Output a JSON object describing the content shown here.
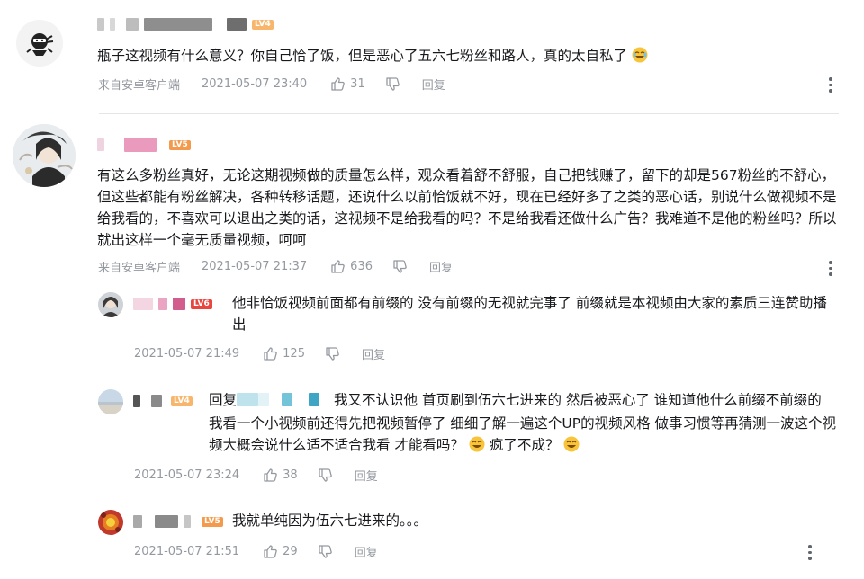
{
  "level_colors": {
    "lv4": "#f7b66c",
    "lv5": "#f39a4c",
    "lv6": "#e8463f"
  },
  "comments": [
    {
      "level": "LV4",
      "content": "瓶子这视频有什么意义？你自己恰了饭，但是恶心了五六七粉丝和路人，真的太自私了",
      "source": "来自安卓客户端",
      "time": "2021-05-07 23:40",
      "likes": "31",
      "reply": "回复"
    },
    {
      "level": "LV5",
      "content": "有这么多粉丝真好，无论这期视频做的质量怎么样，观众看着舒不舒服，自己把钱赚了，留下的却是567粉丝的不舒心，但这些都能有粉丝解决，各种转移话题，还说什么以前恰饭就不好，现在已经好多了之类的恶心话，别说什么做视频不是给我看的，不喜欢可以退出之类的话，这视频不是给我看的吗？不是给我看还做什么广告？我难道不是他的粉丝吗？所以就出这样一个毫无质量视频，呵呵",
      "source": "来自安卓客户端",
      "time": "2021-05-07 21:37",
      "likes": "636",
      "reply": "回复",
      "replies": [
        {
          "level": "LV6",
          "content": "他非恰饭视频前面都有前缀的 没有前缀的无视就完事了 前缀就是本视频由大家的素质三连赞助播出",
          "time": "2021-05-07 21:49",
          "likes": "125",
          "reply": "回复"
        },
        {
          "level": "LV4",
          "reply_prefix": "回复",
          "content": "我又不认识他  首页刷到伍六七进来的  然后被恶心了    谁知道他什么前缀不前缀的  我看一个小视频前还得先把视频暂停了  细细了解一遍这个UP的视频风格  做事习惯等再猜测一波这个视频大概会说什么适不适合我看  才能看吗？",
          "content_tail": "疯了不成？",
          "time": "2021-05-07 23:24",
          "likes": "38",
          "reply": "回复"
        },
        {
          "level": "LV5",
          "content": "我就单纯因为伍六七进来的。。。",
          "time": "2021-05-07 21:51",
          "likes": "29",
          "reply": "回复"
        }
      ]
    }
  ],
  "icons": {
    "like": "thumbs-up-icon",
    "dislike": "thumbs-down-icon",
    "more": "more-vertical-icon",
    "emoji": "laughing-crying-emoji"
  }
}
